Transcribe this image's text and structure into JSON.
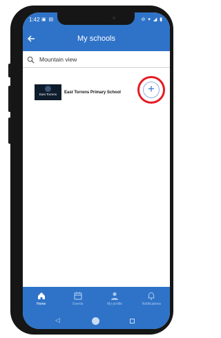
{
  "status_bar": {
    "time": "1:42",
    "left_icons": "▣ ▤",
    "right_icons": "⊘ ▾ ◢ ▮"
  },
  "header": {
    "back_icon": "arrow-left-icon",
    "title": "My schools"
  },
  "search": {
    "icon": "search-icon",
    "value": "Mountain view"
  },
  "results": [
    {
      "logo_text": "East Torrens",
      "name": "East Torrens Primary School",
      "action_icon": "plus-icon"
    }
  ],
  "bottom_nav": [
    {
      "icon": "home-icon",
      "label": "Home",
      "active": true
    },
    {
      "icon": "calendar-icon",
      "label": "Events",
      "active": false
    },
    {
      "icon": "person-icon",
      "label": "My profile",
      "active": false
    },
    {
      "icon": "bell-icon",
      "label": "Notifications",
      "active": false
    }
  ],
  "system_nav": [
    "back-triangle-icon",
    "home-circle-icon",
    "recents-square-icon"
  ],
  "colors": {
    "primary": "#2f73c8",
    "highlight": "#e41b23",
    "phone_frame": "#161616"
  }
}
